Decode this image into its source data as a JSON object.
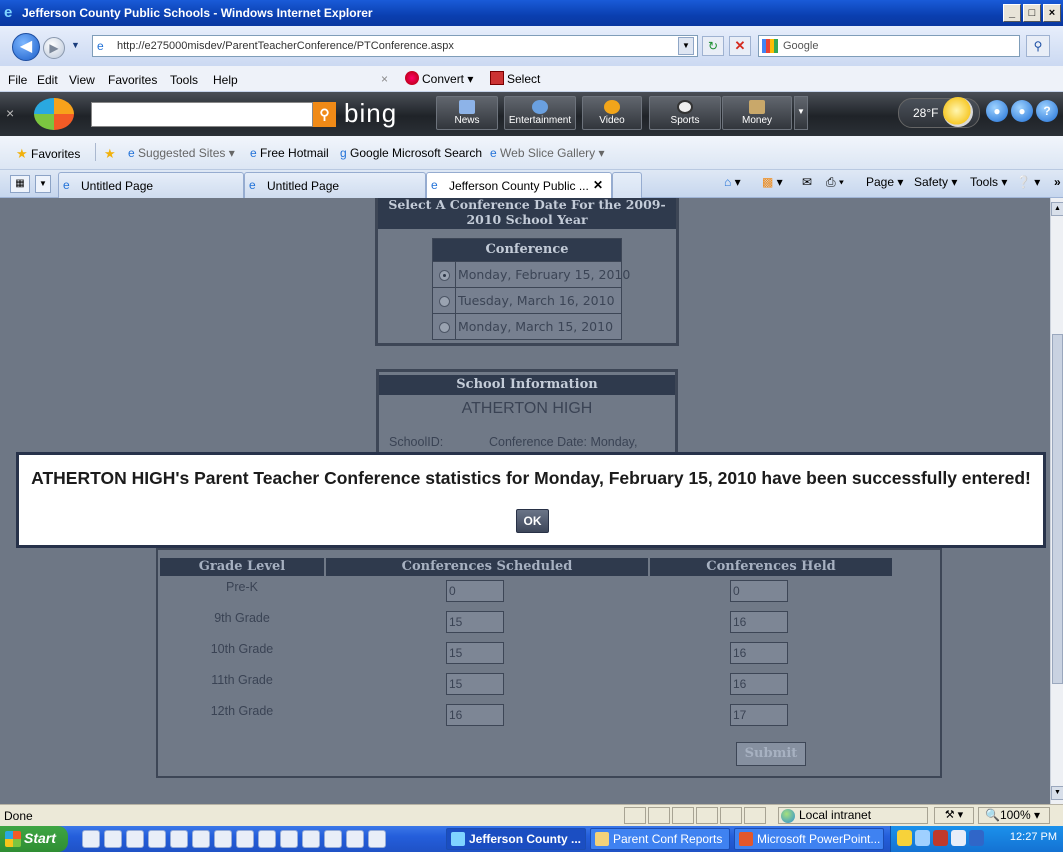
{
  "window": {
    "title": "Jefferson County Public Schools - Windows Internet Explorer",
    "controls": [
      "_",
      "□",
      "×"
    ]
  },
  "address": {
    "url": "http://e275000misdev/ParentTeacherConference/PTConference.aspx",
    "search_placeholder": "Google"
  },
  "menu": {
    "items": [
      "File",
      "Edit",
      "View",
      "Favorites",
      "Tools",
      "Help"
    ],
    "convert": "Convert",
    "select": "Select"
  },
  "bingbar": {
    "logo": "bing",
    "buttons": [
      "News",
      "Entertainment",
      "Video",
      "Sports",
      "Money"
    ],
    "temperature": "28°F"
  },
  "favorites": {
    "label": "Favorites",
    "items": [
      "Suggested Sites",
      "Free Hotmail",
      "Google Microsoft Search",
      "Web Slice Gallery"
    ]
  },
  "tabs": [
    {
      "label": "Untitled Page"
    },
    {
      "label": "Untitled Page"
    },
    {
      "label": "Jefferson County Public ..."
    }
  ],
  "commandbar": {
    "page": "Page",
    "safety": "Safety",
    "tools": "Tools"
  },
  "page": {
    "conference_header": "Select A Conference Date For the 2009-2010 School Year",
    "conference_col": "Conference",
    "conferences": [
      {
        "label": "Monday, February 15, 2010",
        "selected": true
      },
      {
        "label": "Tuesday, March 16, 2010",
        "selected": false
      },
      {
        "label": "Monday, March 15, 2010",
        "selected": false
      }
    ],
    "school_info_header": "School Information",
    "school_name": "ATHERTON HIGH",
    "school_id_label": "SchoolID:",
    "conference_date_label": "Conference Date: Monday,",
    "grid_headers": [
      "Grade Level",
      "Conferences Scheduled",
      "Conferences Held"
    ],
    "grades": [
      {
        "level": "Pre-K",
        "scheduled": "0",
        "held": "0"
      },
      {
        "level": "9th Grade",
        "scheduled": "15",
        "held": "16"
      },
      {
        "level": "10th Grade",
        "scheduled": "15",
        "held": "16"
      },
      {
        "level": "11th Grade",
        "scheduled": "15",
        "held": "16"
      },
      {
        "level": "12th Grade",
        "scheduled": "16",
        "held": "17"
      }
    ],
    "submit_label": "Submit"
  },
  "modal": {
    "message": "ATHERTON HIGH's Parent Teacher Conference statistics for Monday, February 15, 2010 have been successfully entered!",
    "ok_label": "OK"
  },
  "status": {
    "text": "Done",
    "zone": "Local intranet",
    "zoom": "100%"
  },
  "taskbar": {
    "start": "Start",
    "tasks": [
      "Jefferson County ...",
      "Parent Conf Reports",
      "Microsoft PowerPoint..."
    ],
    "clock": "12:27 PM"
  }
}
